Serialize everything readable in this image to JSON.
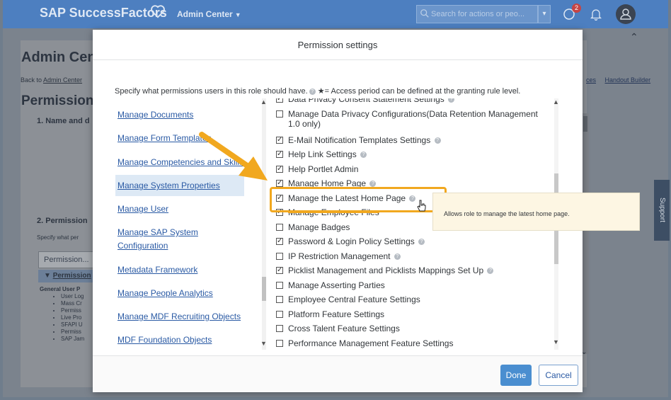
{
  "shell": {
    "logo": "SAP SuccessFactors",
    "admin_center": "Admin Center",
    "search_placeholder": "Search for actions or peo...",
    "notification_count": "2"
  },
  "background": {
    "title": "Admin Cen",
    "back_prefix": "Back to",
    "back_link": "Admin Center",
    "permission_heading": "Permission",
    "section1": "1. Name and d",
    "section2": "2. Permission",
    "specify": "Specify what per",
    "permission_button": "Permission...",
    "permission_row": "Permission",
    "general_heading": "General User P",
    "general_items": [
      "User Log",
      "Mass Cr",
      "Permiss",
      "Live Pro",
      "SFAPI U",
      "Permiss",
      "SAP Jam"
    ],
    "links": [
      "ces",
      "Handout Builder"
    ],
    "support": "Support"
  },
  "dialog": {
    "title": "Permission settings",
    "description": "Specify what permissions users in this role should have.",
    "description_suffix": "★= Access period can be defined at the granting rule level.",
    "left_items": [
      "Manage Documents",
      "Manage Form Templates",
      "Manage Competencies and Skills",
      "Manage System Properties",
      "Manage User",
      "Manage SAP System",
      "Configuration",
      "Metadata Framework",
      "Manage People Analytics",
      "Manage MDF Recruiting Objects",
      "MDF Foundation Objects"
    ],
    "permissions": [
      {
        "label": "Data Privacy Consent Statement Settings",
        "checked": true
      },
      {
        "label": "Manage Data Privacy Configurations(Data Retention Management",
        "checked": false
      },
      {
        "label": "1.0 only)",
        "checked": false
      },
      {
        "label": "E-Mail Notification Templates Settings",
        "checked": true
      },
      {
        "label": "Help Link Settings",
        "checked": true
      },
      {
        "label": "Help Portlet Admin",
        "checked": true
      },
      {
        "label": "Manage Home Page",
        "checked": true
      },
      {
        "label": "Manage the Latest Home Page",
        "checked": true
      },
      {
        "label": "Manage Employee Files",
        "checked": true
      },
      {
        "label": "Manage Badges",
        "checked": false
      },
      {
        "label": "Password & Login Policy Settings",
        "checked": true
      },
      {
        "label": "IP Restriction Management",
        "checked": false
      },
      {
        "label": "Picklist Management and Picklists Mappings Set Up",
        "checked": true
      },
      {
        "label": "Manage Asserting Parties",
        "checked": false
      },
      {
        "label": "Employee Central Feature Settings",
        "checked": false
      },
      {
        "label": "Platform Feature Settings",
        "checked": false
      },
      {
        "label": "Cross Talent Feature Settings",
        "checked": false
      },
      {
        "label": "Performance Management Feature Settings",
        "checked": false
      }
    ],
    "tooltip": "Allows role to manage the latest home page.",
    "done_label": "Done",
    "cancel_label": "Cancel"
  },
  "colors": {
    "accent": "#4a8ed0",
    "highlight": "#f1a81f",
    "shell": "#4d7fc0"
  }
}
